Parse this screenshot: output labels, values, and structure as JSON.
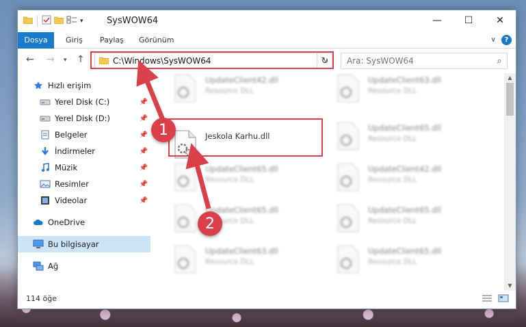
{
  "window": {
    "title": "SysWOW64",
    "controls": {
      "minimize": "—",
      "maximize": "☐",
      "close": "✕"
    }
  },
  "ribbon": {
    "tabs": [
      {
        "label": "Dosya",
        "active": true
      },
      {
        "label": "Giriş"
      },
      {
        "label": "Paylaş"
      },
      {
        "label": "Görünüm"
      }
    ],
    "collapse_icon": "chevron-down-icon",
    "help_label": "?"
  },
  "navigation": {
    "back_icon": "back-arrow-icon",
    "forward_icon": "forward-arrow-icon",
    "recent_icon": "chevron-down-icon",
    "up_icon": "up-arrow-icon"
  },
  "address_bar": {
    "path": "C:\\Windows\\SysWOW64"
  },
  "search": {
    "placeholder": "Ara: SysWOW64"
  },
  "sidebar": {
    "items": [
      {
        "label": "Hızlı erişim",
        "icon": "star-icon",
        "pinned": false
      },
      {
        "label": "Yerel Disk (C:)",
        "icon": "drive-icon",
        "pinned": true
      },
      {
        "label": "Yerel Disk (D:)",
        "icon": "drive-icon",
        "pinned": true
      },
      {
        "label": "Belgeler",
        "icon": "document-icon",
        "pinned": true
      },
      {
        "label": "İndirmeler",
        "icon": "download-icon",
        "pinned": true
      },
      {
        "label": "Müzik",
        "icon": "music-icon",
        "pinned": true
      },
      {
        "label": "Resimler",
        "icon": "picture-icon",
        "pinned": true
      },
      {
        "label": "Videolar",
        "icon": "video-icon",
        "pinned": true
      },
      {
        "label": "OneDrive",
        "icon": "cloud-icon",
        "pinned": false
      },
      {
        "label": "Bu bilgisayar",
        "icon": "computer-icon",
        "pinned": false,
        "selected": true
      },
      {
        "label": "Ağ",
        "icon": "network-icon",
        "pinned": false
      }
    ]
  },
  "files": [
    {
      "name": "UpdateClient42.dll",
      "type": "Resource DLL",
      "blurred": true
    },
    {
      "name": "UpdateClient63.dll",
      "type": "Resource DLL",
      "blurred": true
    },
    {
      "name": "Jeskola Karhu.dll",
      "type": "",
      "blurred": false
    },
    {
      "name": "UpdateClient65.dll",
      "type": "Resource DLL",
      "blurred": true
    },
    {
      "name": "UpdateClient65.dll",
      "type": "Resource DLL",
      "blurred": true
    },
    {
      "name": "UpdateClient42.dll",
      "type": "Resource DLL",
      "blurred": true
    },
    {
      "name": "UpdateClient65.dll",
      "type": "Resource DLL",
      "blurred": true
    },
    {
      "name": "UpdateClient65.dll",
      "type": "Resource DLL",
      "blurred": true
    },
    {
      "name": "UpdateClient63.dll",
      "type": "Resource DLL",
      "blurred": true
    },
    {
      "name": "UpdateClient65.dll",
      "type": "Resource DLL",
      "blurred": true
    }
  ],
  "status": {
    "item_count": "114 öğe"
  },
  "annotations": {
    "step1": "1",
    "step2": "2",
    "highlight_color": "#d9404a"
  }
}
